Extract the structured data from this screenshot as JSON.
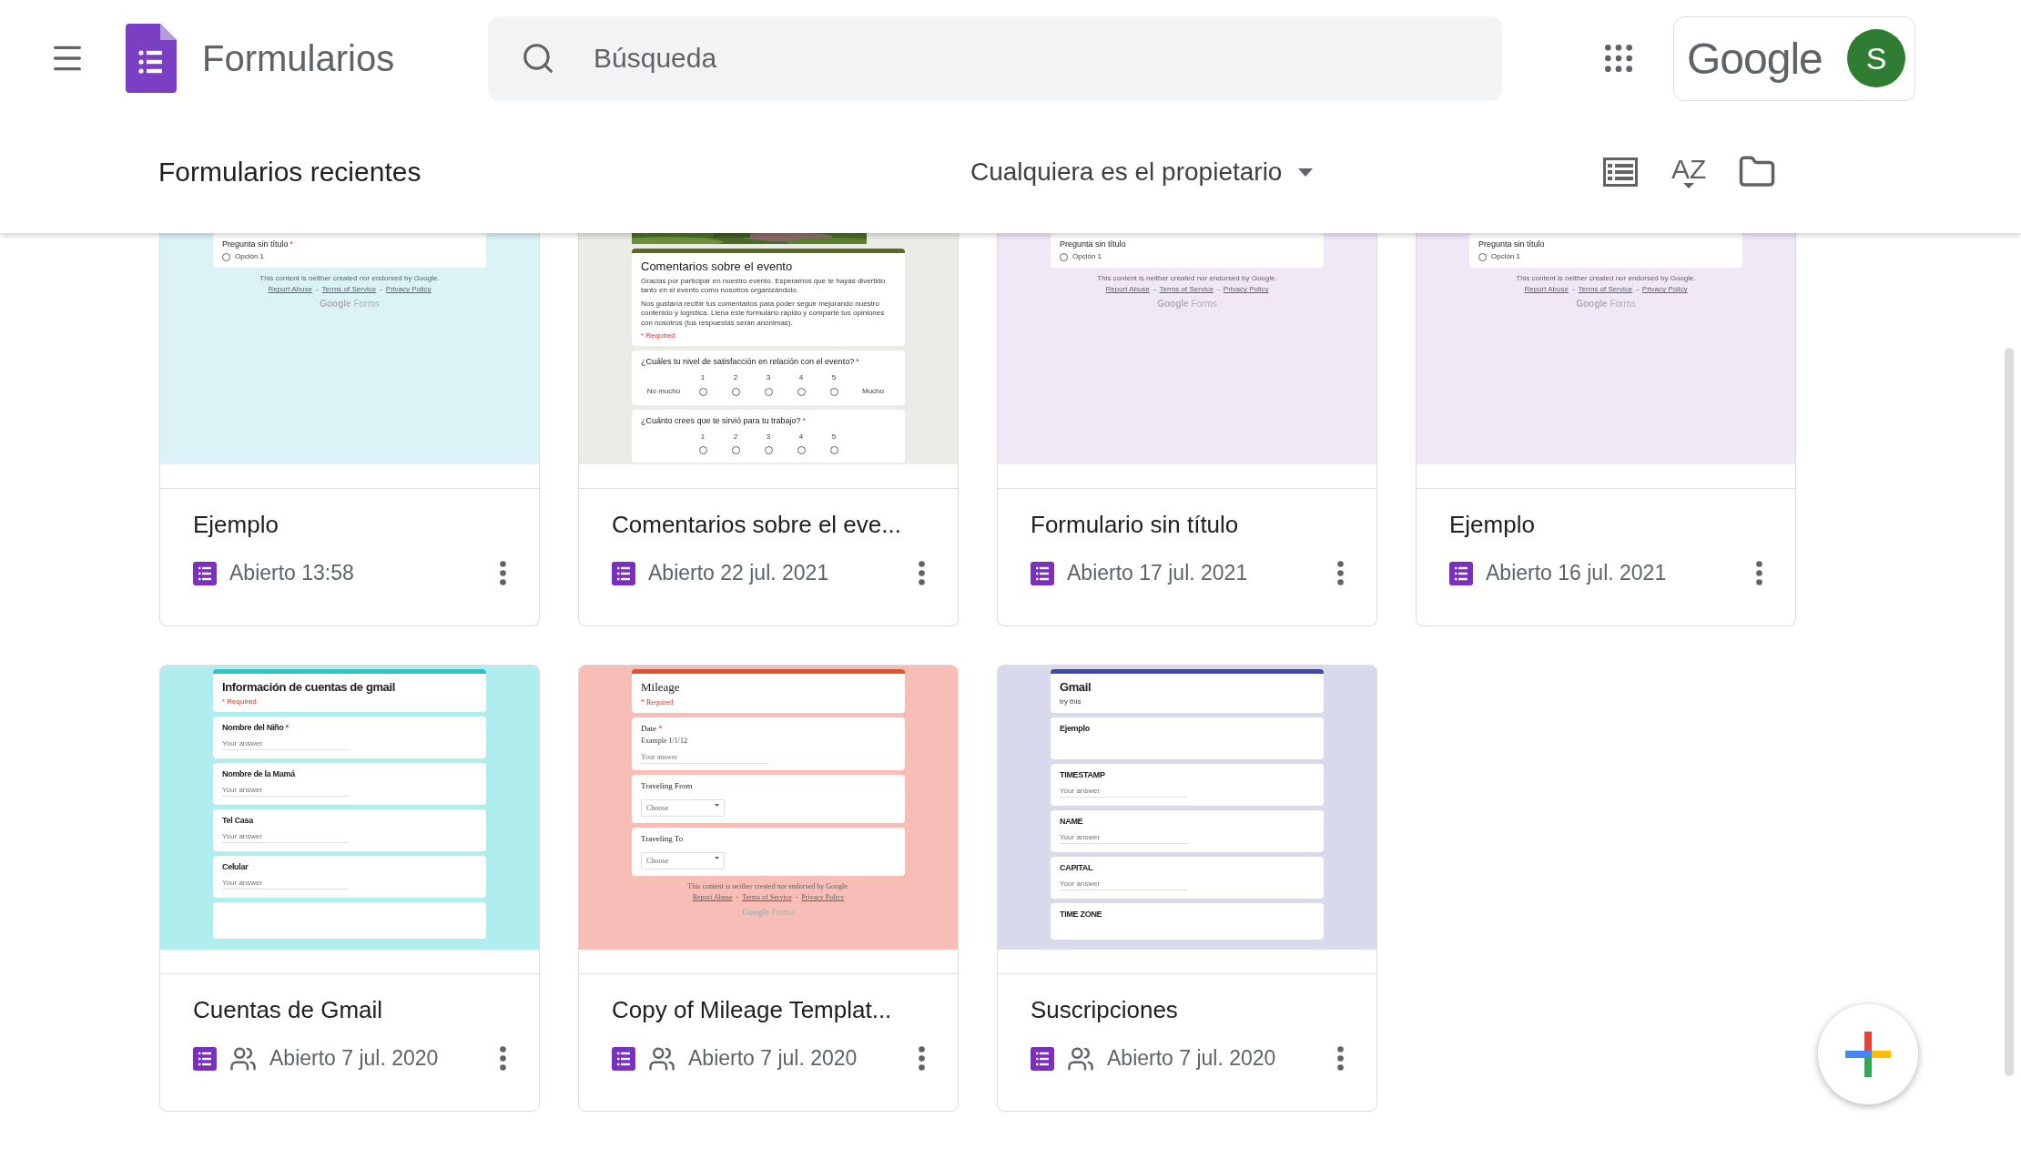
{
  "app": {
    "title": "Formularios"
  },
  "search": {
    "placeholder": "Búsqueda"
  },
  "account": {
    "brand": "Google",
    "avatar_initial": "S"
  },
  "section": {
    "title": "Formularios recientes",
    "owner_filter": "Cualquiera es el propietario",
    "sort_label": "AZ"
  },
  "forms": [
    {
      "title": "Ejemplo",
      "opened": "Abierto 13:58",
      "shared": false,
      "thumbnail": {
        "color": "#dbf3f7",
        "kind": "plain",
        "blocks": [
          {
            "kind": "choice",
            "label": "Pregunta sin título",
            "mark": "*",
            "option": "Opción 1"
          },
          {
            "kind": "footer",
            "disclaimer": "This content is neither created nor endorsed by Google.",
            "links": [
              "Report Abuse",
              "Terms of Service",
              "Privacy Policy"
            ],
            "separator": "-",
            "brand": [
              "Google",
              "Forms"
            ]
          }
        ]
      }
    },
    {
      "title": "Comentarios sobre el eve...",
      "opened": "Abierto 22 jul. 2021",
      "shared": false,
      "thumbnail": {
        "color": "#ebece6",
        "kind": "plain",
        "blocks": [
          {
            "kind": "picture"
          },
          {
            "kind": "header",
            "color": "#5a6b1f",
            "title": "Comentarios sobre el evento",
            "description": [
              "Gracias por participar en nuestro evento. Esperamos que te hayas divertido tanto en el evento como nosotros organizándolo.",
              "Nos gustaría recibir tus comentarios para poder seguir mejorando nuestro contenido y logística. Llena este formulario rápido y comparte tus opiniones con nosotros (tus respuestas serán anónimas)."
            ],
            "note": "* Required"
          },
          {
            "kind": "scale",
            "label": "¿Cuáles tu nivel de satisfacción en relación con el evento?",
            "mark": "*",
            "points": [
              "1",
              "2",
              "3",
              "4",
              "5"
            ],
            "low": "No mucho",
            "high": "Mucho"
          },
          {
            "kind": "scale",
            "label": "¿Cuánto crees que te sirvió para tu trabajo?",
            "mark": "*",
            "points": [
              "1",
              "2",
              "3",
              "4",
              "5"
            ]
          }
        ]
      }
    },
    {
      "title": "Formulario sin título",
      "opened": "Abierto 17 jul. 2021",
      "shared": false,
      "thumbnail": {
        "color": "#f0e8f7",
        "kind": "plain",
        "blocks": [
          {
            "kind": "choice",
            "label": "Pregunta sin título",
            "option": "Opción 1"
          },
          {
            "kind": "footer",
            "disclaimer": "This content is neither created nor endorsed by Google.",
            "links": [
              "Report Abuse",
              "Terms of Service",
              "Privacy Policy"
            ],
            "separator": "-",
            "brand": [
              "Google",
              "Forms"
            ]
          }
        ]
      }
    },
    {
      "title": "Ejemplo",
      "opened": "Abierto 16 jul. 2021",
      "shared": false,
      "thumbnail": {
        "color": "#f0e8f7",
        "kind": "plain",
        "blocks": [
          {
            "kind": "choice",
            "label": "Pregunta sin título",
            "option": "Opción 1"
          },
          {
            "kind": "footer",
            "disclaimer": "This content is neither created nor endorsed by Google.",
            "links": [
              "Report Abuse",
              "Terms of Service",
              "Privacy Policy"
            ],
            "separator": "-",
            "brand": [
              "Google",
              "Forms"
            ]
          }
        ]
      }
    },
    {
      "title": "Cuentas de Gmail",
      "opened": "Abierto 7 jul. 2020",
      "shared": true,
      "thumbnail": {
        "color": "#b0edee",
        "kind": "condensed",
        "blocks": [
          {
            "kind": "header",
            "color": "#26c6cf",
            "title": "Información de cuentas de gmail",
            "note": "* Required"
          },
          {
            "kind": "text",
            "label": "Nombre del Niño",
            "mark": "*",
            "answer": "Your answer"
          },
          {
            "kind": "text",
            "label": "Nombre de la Mamá",
            "answer": "Your answer"
          },
          {
            "kind": "text",
            "label": "Tel Casa",
            "answer": "Your answer"
          },
          {
            "kind": "text",
            "label": "Celular",
            "answer": "Your answer"
          },
          {
            "kind": "stub"
          }
        ]
      }
    },
    {
      "title": "Copy of Mileage Templat...",
      "opened": "Abierto 7 jul. 2020",
      "shared": true,
      "thumbnail": {
        "color": "#f8beb5",
        "kind": "serif",
        "blocks": [
          {
            "kind": "header",
            "color": "#e4512f",
            "title": "Mileage",
            "note": "* Required"
          },
          {
            "kind": "text",
            "label": "Date",
            "mark": "*",
            "hint": "Example 1/1/12",
            "answer": "Your answer"
          },
          {
            "kind": "dropdown",
            "label": "Traveling From",
            "placeholder": "Choose"
          },
          {
            "kind": "dropdown",
            "label": "Traveling To",
            "placeholder": "Choose"
          },
          {
            "kind": "footer",
            "disclaimer": "This content is neither created nor endorsed by Google.",
            "links": [
              "Report Abuse",
              "Terms of Service",
              "Privacy Policy"
            ],
            "separator": "-",
            "brand": [
              "Google",
              "Forms"
            ]
          }
        ]
      }
    },
    {
      "title": "Suscripciones",
      "opened": "Abierto 7 jul. 2020",
      "shared": true,
      "thumbnail": {
        "color": "#d9d9ee",
        "kind": "condensed",
        "blocks": [
          {
            "kind": "header",
            "color": "#3f4aa8",
            "title": "Gmail",
            "description": [
              "try this"
            ]
          },
          {
            "kind": "text",
            "label": "Ejemplo"
          },
          {
            "kind": "text",
            "label": "TIMESTAMP",
            "answer": "Your answer"
          },
          {
            "kind": "text",
            "label": "NAME",
            "answer": "Your answer"
          },
          {
            "kind": "text",
            "label": "CAPITAL",
            "answer": "Your answer"
          },
          {
            "kind": "stub",
            "label": "TIME ZONE"
          }
        ]
      }
    }
  ]
}
